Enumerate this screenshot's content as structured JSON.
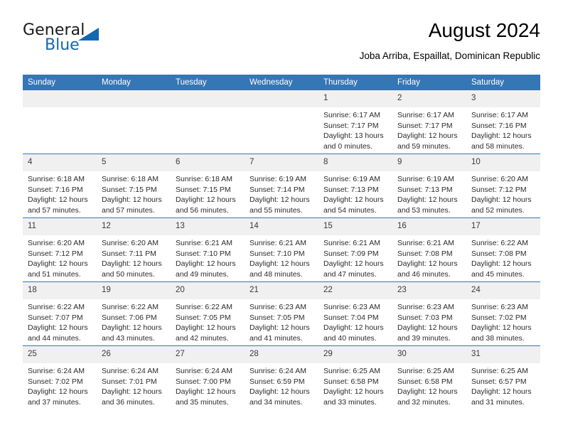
{
  "brand": {
    "name_part1": "General",
    "name_part2": "Blue",
    "accent_color": "#1468b0"
  },
  "header": {
    "month_title": "August 2024",
    "location": "Joba Arriba, Espaillat, Dominican Republic"
  },
  "theme": {
    "header_bg": "#3576b5",
    "daynum_bg": "#f0f0f0",
    "text_color": "#2b2b2b"
  },
  "weekdays": [
    "Sunday",
    "Monday",
    "Tuesday",
    "Wednesday",
    "Thursday",
    "Friday",
    "Saturday"
  ],
  "labels": {
    "sunrise": "Sunrise:",
    "sunset": "Sunset:",
    "daylight": "Daylight:"
  },
  "weeks": [
    [
      {
        "day": "",
        "empty": true
      },
      {
        "day": "",
        "empty": true
      },
      {
        "day": "",
        "empty": true
      },
      {
        "day": "",
        "empty": true
      },
      {
        "day": "1",
        "sunrise": "Sunrise: 6:17 AM",
        "sunset": "Sunset: 7:17 PM",
        "daylight": "Daylight: 13 hours and 0 minutes."
      },
      {
        "day": "2",
        "sunrise": "Sunrise: 6:17 AM",
        "sunset": "Sunset: 7:17 PM",
        "daylight": "Daylight: 12 hours and 59 minutes."
      },
      {
        "day": "3",
        "sunrise": "Sunrise: 6:17 AM",
        "sunset": "Sunset: 7:16 PM",
        "daylight": "Daylight: 12 hours and 58 minutes."
      }
    ],
    [
      {
        "day": "4",
        "sunrise": "Sunrise: 6:18 AM",
        "sunset": "Sunset: 7:16 PM",
        "daylight": "Daylight: 12 hours and 57 minutes."
      },
      {
        "day": "5",
        "sunrise": "Sunrise: 6:18 AM",
        "sunset": "Sunset: 7:15 PM",
        "daylight": "Daylight: 12 hours and 57 minutes."
      },
      {
        "day": "6",
        "sunrise": "Sunrise: 6:18 AM",
        "sunset": "Sunset: 7:15 PM",
        "daylight": "Daylight: 12 hours and 56 minutes."
      },
      {
        "day": "7",
        "sunrise": "Sunrise: 6:19 AM",
        "sunset": "Sunset: 7:14 PM",
        "daylight": "Daylight: 12 hours and 55 minutes."
      },
      {
        "day": "8",
        "sunrise": "Sunrise: 6:19 AM",
        "sunset": "Sunset: 7:13 PM",
        "daylight": "Daylight: 12 hours and 54 minutes."
      },
      {
        "day": "9",
        "sunrise": "Sunrise: 6:19 AM",
        "sunset": "Sunset: 7:13 PM",
        "daylight": "Daylight: 12 hours and 53 minutes."
      },
      {
        "day": "10",
        "sunrise": "Sunrise: 6:20 AM",
        "sunset": "Sunset: 7:12 PM",
        "daylight": "Daylight: 12 hours and 52 minutes."
      }
    ],
    [
      {
        "day": "11",
        "sunrise": "Sunrise: 6:20 AM",
        "sunset": "Sunset: 7:12 PM",
        "daylight": "Daylight: 12 hours and 51 minutes."
      },
      {
        "day": "12",
        "sunrise": "Sunrise: 6:20 AM",
        "sunset": "Sunset: 7:11 PM",
        "daylight": "Daylight: 12 hours and 50 minutes."
      },
      {
        "day": "13",
        "sunrise": "Sunrise: 6:21 AM",
        "sunset": "Sunset: 7:10 PM",
        "daylight": "Daylight: 12 hours and 49 minutes."
      },
      {
        "day": "14",
        "sunrise": "Sunrise: 6:21 AM",
        "sunset": "Sunset: 7:10 PM",
        "daylight": "Daylight: 12 hours and 48 minutes."
      },
      {
        "day": "15",
        "sunrise": "Sunrise: 6:21 AM",
        "sunset": "Sunset: 7:09 PM",
        "daylight": "Daylight: 12 hours and 47 minutes."
      },
      {
        "day": "16",
        "sunrise": "Sunrise: 6:21 AM",
        "sunset": "Sunset: 7:08 PM",
        "daylight": "Daylight: 12 hours and 46 minutes."
      },
      {
        "day": "17",
        "sunrise": "Sunrise: 6:22 AM",
        "sunset": "Sunset: 7:08 PM",
        "daylight": "Daylight: 12 hours and 45 minutes."
      }
    ],
    [
      {
        "day": "18",
        "sunrise": "Sunrise: 6:22 AM",
        "sunset": "Sunset: 7:07 PM",
        "daylight": "Daylight: 12 hours and 44 minutes."
      },
      {
        "day": "19",
        "sunrise": "Sunrise: 6:22 AM",
        "sunset": "Sunset: 7:06 PM",
        "daylight": "Daylight: 12 hours and 43 minutes."
      },
      {
        "day": "20",
        "sunrise": "Sunrise: 6:22 AM",
        "sunset": "Sunset: 7:05 PM",
        "daylight": "Daylight: 12 hours and 42 minutes."
      },
      {
        "day": "21",
        "sunrise": "Sunrise: 6:23 AM",
        "sunset": "Sunset: 7:05 PM",
        "daylight": "Daylight: 12 hours and 41 minutes."
      },
      {
        "day": "22",
        "sunrise": "Sunrise: 6:23 AM",
        "sunset": "Sunset: 7:04 PM",
        "daylight": "Daylight: 12 hours and 40 minutes."
      },
      {
        "day": "23",
        "sunrise": "Sunrise: 6:23 AM",
        "sunset": "Sunset: 7:03 PM",
        "daylight": "Daylight: 12 hours and 39 minutes."
      },
      {
        "day": "24",
        "sunrise": "Sunrise: 6:23 AM",
        "sunset": "Sunset: 7:02 PM",
        "daylight": "Daylight: 12 hours and 38 minutes."
      }
    ],
    [
      {
        "day": "25",
        "sunrise": "Sunrise: 6:24 AM",
        "sunset": "Sunset: 7:02 PM",
        "daylight": "Daylight: 12 hours and 37 minutes."
      },
      {
        "day": "26",
        "sunrise": "Sunrise: 6:24 AM",
        "sunset": "Sunset: 7:01 PM",
        "daylight": "Daylight: 12 hours and 36 minutes."
      },
      {
        "day": "27",
        "sunrise": "Sunrise: 6:24 AM",
        "sunset": "Sunset: 7:00 PM",
        "daylight": "Daylight: 12 hours and 35 minutes."
      },
      {
        "day": "28",
        "sunrise": "Sunrise: 6:24 AM",
        "sunset": "Sunset: 6:59 PM",
        "daylight": "Daylight: 12 hours and 34 minutes."
      },
      {
        "day": "29",
        "sunrise": "Sunrise: 6:25 AM",
        "sunset": "Sunset: 6:58 PM",
        "daylight": "Daylight: 12 hours and 33 minutes."
      },
      {
        "day": "30",
        "sunrise": "Sunrise: 6:25 AM",
        "sunset": "Sunset: 6:58 PM",
        "daylight": "Daylight: 12 hours and 32 minutes."
      },
      {
        "day": "31",
        "sunrise": "Sunrise: 6:25 AM",
        "sunset": "Sunset: 6:57 PM",
        "daylight": "Daylight: 12 hours and 31 minutes."
      }
    ]
  ]
}
